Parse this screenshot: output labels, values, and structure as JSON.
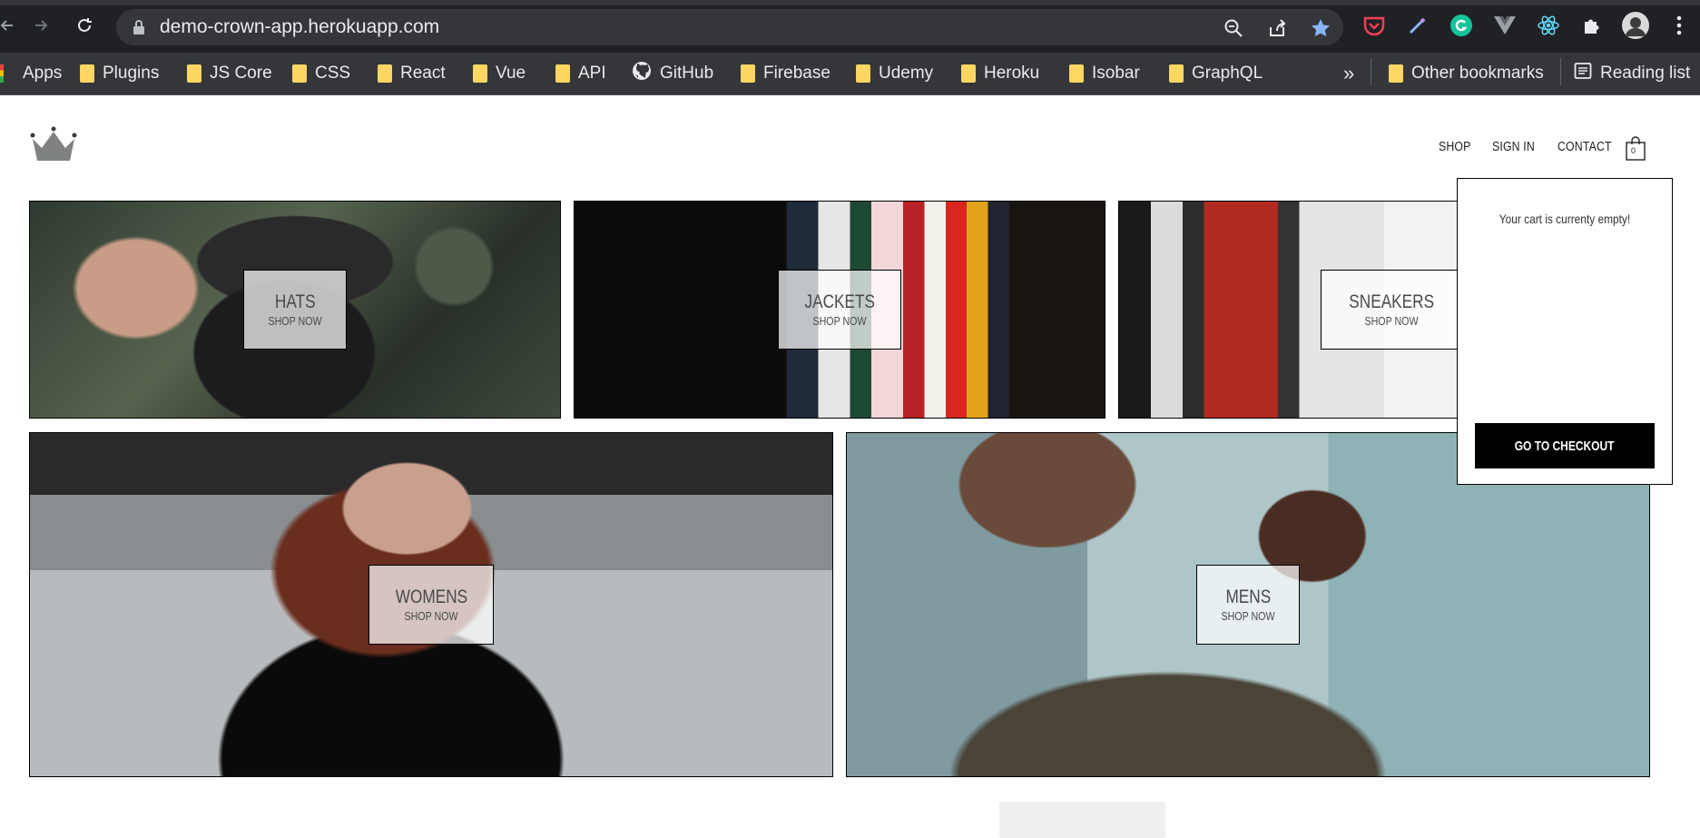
{
  "browser": {
    "url": "demo-crown-app.herokuapp.com",
    "bookmarks": [
      {
        "label": "Apps",
        "type": "apps"
      },
      {
        "label": "Plugins",
        "type": "folder"
      },
      {
        "label": "JS Core",
        "type": "folder"
      },
      {
        "label": "CSS",
        "type": "folder"
      },
      {
        "label": "React",
        "type": "folder"
      },
      {
        "label": "Vue",
        "type": "folder"
      },
      {
        "label": "API",
        "type": "folder"
      },
      {
        "label": "GitHub",
        "type": "github"
      },
      {
        "label": "Firebase",
        "type": "folder"
      },
      {
        "label": "Udemy",
        "type": "folder"
      },
      {
        "label": "Heroku",
        "type": "folder"
      },
      {
        "label": "Isobar",
        "type": "folder"
      },
      {
        "label": "GraphQL",
        "type": "folder"
      }
    ],
    "overflow_label": "»",
    "other_bookmarks": "Other bookmarks",
    "reading_list": "Reading list"
  },
  "header": {
    "nav": {
      "shop": "SHOP",
      "sign_in": "SIGN IN",
      "contact": "CONTACT"
    },
    "cart_count": "0"
  },
  "directory": [
    {
      "title": "HATS",
      "subtitle": "SHOP NOW"
    },
    {
      "title": "JACKETS",
      "subtitle": "SHOP NOW"
    },
    {
      "title": "SNEAKERS",
      "subtitle": "SHOP NOW"
    },
    {
      "title": "WOMENS",
      "subtitle": "SHOP NOW"
    },
    {
      "title": "MENS",
      "subtitle": "SHOP NOW"
    }
  ],
  "cart_dropdown": {
    "empty_message": "Your cart is currenty empty!",
    "checkout_label": "GO TO CHECKOUT"
  },
  "colors": {
    "chrome_bg": "#202124",
    "bookmark_bar": "#35363a",
    "folder": "#fdd663",
    "accent_star": "#8ab4f8",
    "button": "#000000"
  }
}
